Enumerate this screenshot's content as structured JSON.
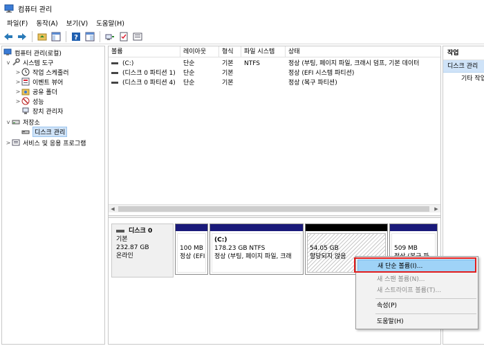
{
  "window": {
    "title": "컴퓨터 관리"
  },
  "menu": [
    "파일(F)",
    "동작(A)",
    "보기(V)",
    "도움말(H)"
  ],
  "toolbar": {
    "icons": [
      "back-icon",
      "forward-icon",
      "up-folder-icon",
      "show-hide-tree-icon",
      "help-icon",
      "properties-icon",
      "connect-icon",
      "checklist-icon",
      "view-icon"
    ]
  },
  "tree": {
    "root": "컴퓨터 관리(로컬)",
    "system_tools": "시스템 도구",
    "task_scheduler": "작업 스케줄러",
    "event_viewer": "이벤트 뷰어",
    "shared_folders": "공유 폴더",
    "performance": "성능",
    "device_manager": "장치 관리자",
    "storage": "저장소",
    "disk_management": "디스크 관리",
    "services_apps": "서비스 및 응용 프로그램"
  },
  "volumes": {
    "columns": [
      "볼륨",
      "레이아웃",
      "형식",
      "파일 시스템",
      "상태"
    ],
    "rows": [
      [
        "(C:)",
        "단순",
        "기본",
        "NTFS",
        "정상 (부팅, 페이지 파일, 크래시 덤프, 기본 데이터"
      ],
      [
        "(디스크 0 파티션 1)",
        "단순",
        "기본",
        "",
        "정상 (EFI 시스템 파티션)"
      ],
      [
        "(디스크 0 파티션 4)",
        "단순",
        "기본",
        "",
        "정상 (복구 파티션)"
      ]
    ]
  },
  "disk": {
    "name": "디스크 0",
    "type": "기본",
    "size": "232.87 GB",
    "status": "온라인",
    "partitions": [
      {
        "name": "",
        "size": "100 MB",
        "status": "정상 (EFI"
      },
      {
        "name": "(C:)",
        "size": "178.23 GB NTFS",
        "status": "정상 (부팅, 페이지 파일, 크래"
      },
      {
        "name": "",
        "size": "54.05 GB",
        "status": "할당되지 않음"
      },
      {
        "name": "",
        "size": "509 MB",
        "status": "정상 (복구 파"
      }
    ]
  },
  "actions": {
    "header": "작업",
    "selected": "디스크 관리",
    "other": "기타 작업"
  },
  "context_menu": {
    "new_simple": "새 단순 볼륨(I)...",
    "new_spanned": "새 스팬 볼륨(N)...",
    "new_striped": "새 스트라이프 볼륨(T)...",
    "properties": "속성(P)",
    "help": "도움말(H)"
  },
  "colors": {
    "primary_partition_bar": "#1a1a7a",
    "unallocated_bar": "#000000",
    "highlight": "#9fd3f7",
    "callout": "#e21c1c"
  }
}
